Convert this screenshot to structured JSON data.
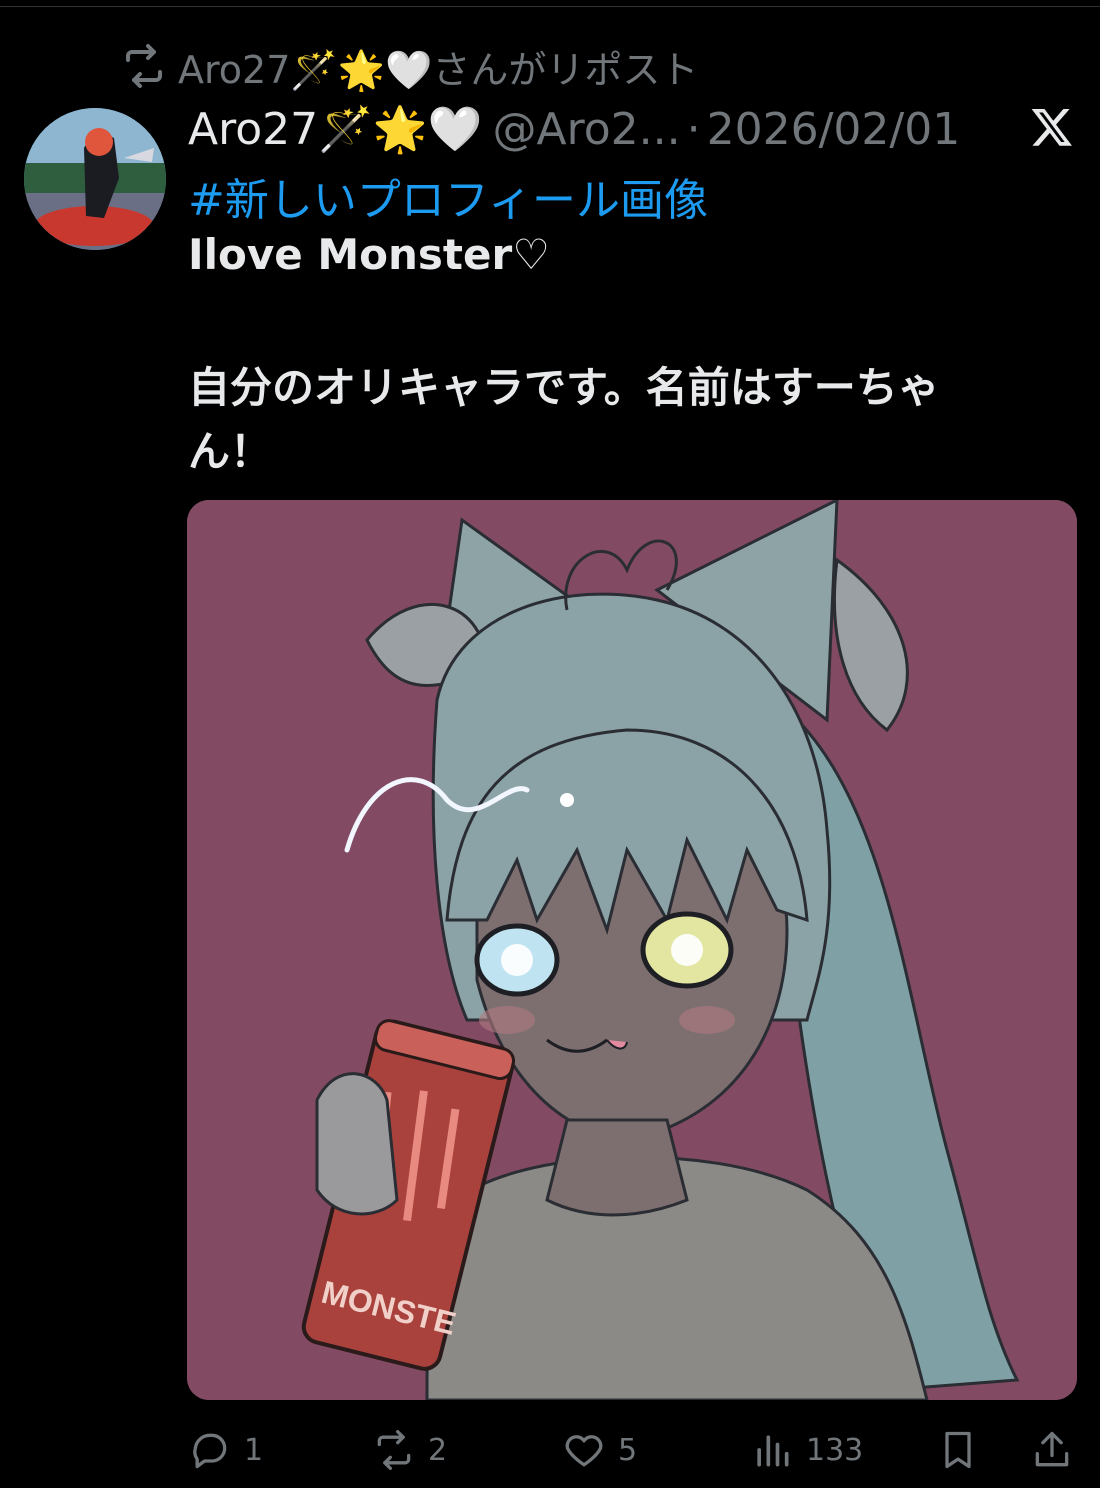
{
  "repost": {
    "icon": "repost-icon",
    "text": "Aro27🪄🌟🤍さんがリポスト"
  },
  "post": {
    "author_name": "Aro27🪄🌟🤍",
    "handle": "@Aro2...",
    "separator": "·",
    "date": "2026/02/01",
    "hashtag": "#新しいプロフィール画像",
    "lines": [
      "Ilove Monster♡",
      "自分のオリキャラです。名前はすーちゃ",
      "ん！"
    ],
    "image_text": "MONSTE"
  },
  "actions": {
    "replies": "1",
    "reposts": "2",
    "likes": "5",
    "views": "133"
  },
  "colors": {
    "background": "#000000",
    "link": "#1d9bf0",
    "muted": "#71767b",
    "image_bg": "#824b63"
  }
}
